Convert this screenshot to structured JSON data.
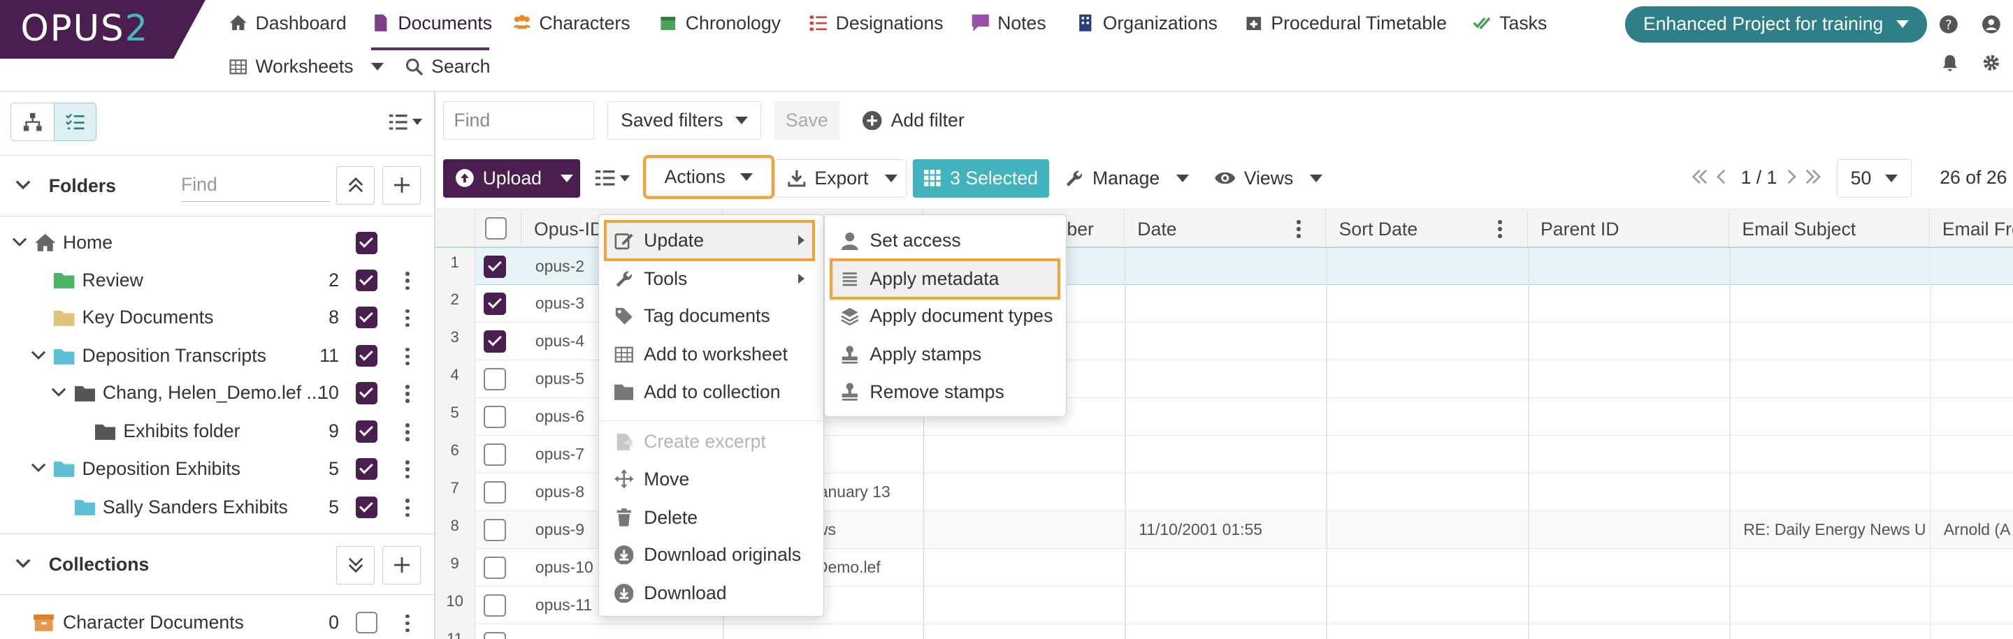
{
  "brand": {
    "logo_main": "OPUS",
    "logo_num": "2"
  },
  "nav": {
    "items": [
      "Dashboard",
      "Documents",
      "Characters",
      "Chronology",
      "Designations",
      "Notes",
      "Organizations",
      "Procedural Timetable",
      "Tasks"
    ],
    "row2": [
      "Worksheets",
      "Search"
    ],
    "project": "Enhanced Project for training",
    "active": "Documents"
  },
  "left_panel": {
    "folders_title": "Folders",
    "find_placeholder": "Find",
    "folders": [
      {
        "label": "Home",
        "count": "",
        "checked": true
      },
      {
        "label": "Review",
        "count": "2",
        "checked": true
      },
      {
        "label": "Key Documents",
        "count": "8",
        "checked": true
      },
      {
        "label": "Deposition Transcripts",
        "count": "11",
        "checked": true
      },
      {
        "label": "Chang, Helen_Demo.lef ...",
        "count": "10",
        "checked": true
      },
      {
        "label": "Exhibits folder",
        "count": "9",
        "checked": true
      },
      {
        "label": "Deposition Exhibits",
        "count": "5",
        "checked": true
      },
      {
        "label": "Sally Sanders Exhibits",
        "count": "5",
        "checked": true
      }
    ],
    "collections_title": "Collections",
    "collections": [
      {
        "label": "Character Documents",
        "count": "0",
        "checked": false
      }
    ]
  },
  "toolbar": {
    "find_placeholder": "Find",
    "saved_filters": "Saved filters",
    "save": "Save",
    "add_filter": "Add filter",
    "upload": "Upload",
    "actions": "Actions",
    "export": "Export",
    "selected": "3 Selected",
    "manage": "Manage",
    "views": "Views",
    "page": "1 / 1",
    "page_size": "50",
    "total": "26 of 26"
  },
  "grid": {
    "columns": [
      "Opus-ID",
      "",
      "mber",
      "Date",
      "Sort Date",
      "Parent ID",
      "Email Subject",
      "Email Fro"
    ],
    "rows": [
      {
        "n": "1",
        "id": "opus-2",
        "checked": true,
        "title": "",
        "date": "",
        "subject": "",
        "from": ""
      },
      {
        "n": "2",
        "id": "opus-3",
        "checked": true,
        "title": "",
        "date": "",
        "subject": "",
        "from": ""
      },
      {
        "n": "3",
        "id": "opus-4",
        "checked": true,
        "title": "",
        "date": "",
        "subject": "",
        "from": ""
      },
      {
        "n": "4",
        "id": "opus-5",
        "checked": false,
        "title": "",
        "date": "",
        "subject": "",
        "from": ""
      },
      {
        "n": "5",
        "id": "opus-6",
        "checked": false,
        "title": "",
        "date": "",
        "subject": "",
        "from": ""
      },
      {
        "n": "6",
        "id": "opus-7",
        "checked": false,
        "title": "",
        "date": "",
        "subject": "",
        "from": ""
      },
      {
        "n": "7",
        "id": "opus-8",
        "checked": false,
        "title": "s January 13",
        "date": "",
        "subject": "",
        "from": ""
      },
      {
        "n": "8",
        "id": "opus-9",
        "checked": false,
        "title": "news",
        "date": "11/10/2001 01:55",
        "subject": "RE: Daily Energy News U",
        "from": "Arnold (A"
      },
      {
        "n": "9",
        "id": "opus-10",
        "checked": false,
        "title": "n_Demo.lef",
        "date": "",
        "subject": "",
        "from": ""
      },
      {
        "n": "10",
        "id": "opus-11",
        "checked": false,
        "title": "",
        "date": "",
        "subject": "",
        "from": ""
      },
      {
        "n": "11",
        "id": "",
        "checked": false,
        "title": "",
        "date": "",
        "subject": "",
        "from": ""
      }
    ]
  },
  "actions_menu": {
    "items": [
      "Update",
      "Tools",
      "Tag documents",
      "Add to worksheet",
      "Add to collection",
      "Create excerpt",
      "Move",
      "Delete",
      "Download originals",
      "Download"
    ]
  },
  "update_submenu": {
    "items": [
      "Set access",
      "Apply metadata",
      "Apply document types",
      "Apply stamps",
      "Remove stamps"
    ]
  },
  "colors": {
    "brand": "#4a1f4f",
    "teal": "#2e7f88",
    "accent_teal": "#41b3bd",
    "highlight": "#f0a43a"
  }
}
